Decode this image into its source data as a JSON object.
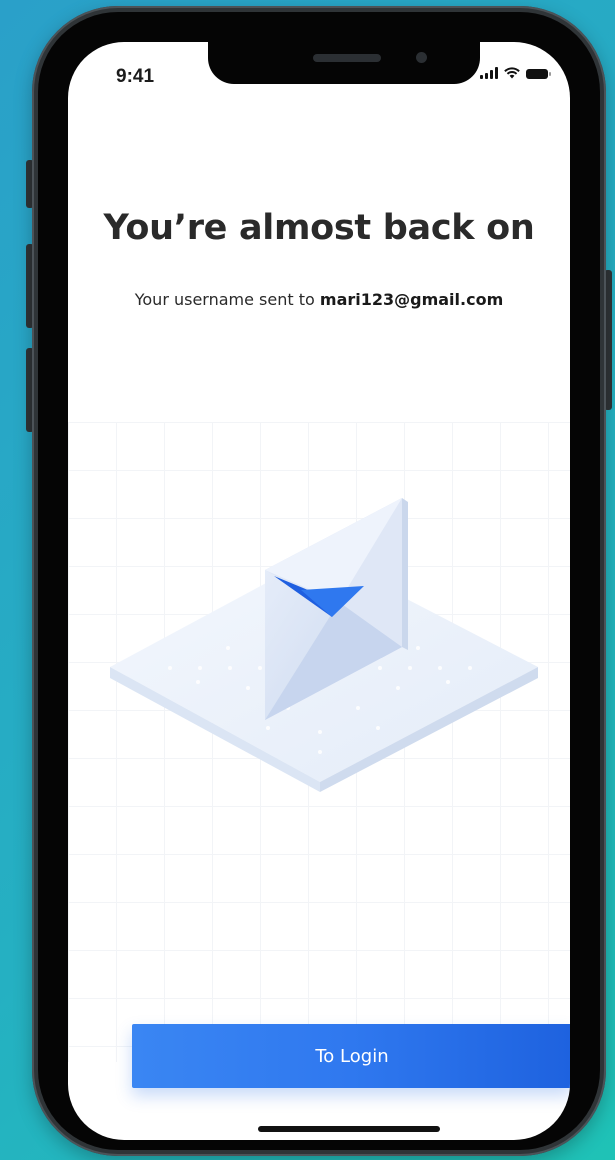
{
  "status_bar": {
    "time": "9:41",
    "icons": [
      "cellular-signal-icon",
      "wifi-icon",
      "battery-icon"
    ]
  },
  "content": {
    "title": "You’re almost back on",
    "subtitle_prefix": "Your username sent to ",
    "email": "mari123@gmail.com"
  },
  "illustration": {
    "subject": "envelope-icon",
    "accent_color": "#1f5fe0"
  },
  "action": {
    "login_label": "To Login"
  },
  "colors": {
    "background": "#27a8c6",
    "primary_button": "#2f78ef",
    "text": "#2a2a2a"
  }
}
